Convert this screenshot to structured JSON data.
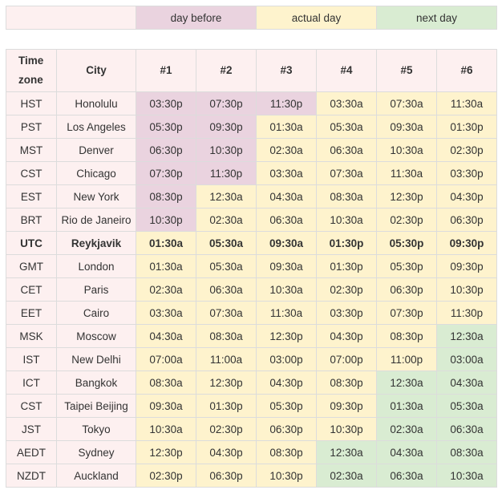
{
  "legend": {
    "day_before": "day before",
    "actual_day": "actual day",
    "next_day": "next day"
  },
  "colors": {
    "day_before": "#ead3df",
    "actual_day": "#fef3cd",
    "next_day": "#d9ecd2",
    "label_bg": "#fdf0f0"
  },
  "headers": [
    "Time zone",
    "City",
    "#1",
    "#2",
    "#3",
    "#4",
    "#5",
    "#6"
  ],
  "rows": [
    {
      "tz": "HST",
      "city": "Honolulu",
      "times": [
        "03:30p",
        "07:30p",
        "11:30p",
        "03:30a",
        "07:30a",
        "11:30a"
      ],
      "days": [
        "before",
        "before",
        "before",
        "actual",
        "actual",
        "actual"
      ]
    },
    {
      "tz": "PST",
      "city": "Los Angeles",
      "times": [
        "05:30p",
        "09:30p",
        "01:30a",
        "05:30a",
        "09:30a",
        "01:30p"
      ],
      "days": [
        "before",
        "before",
        "actual",
        "actual",
        "actual",
        "actual"
      ]
    },
    {
      "tz": "MST",
      "city": "Denver",
      "times": [
        "06:30p",
        "10:30p",
        "02:30a",
        "06:30a",
        "10:30a",
        "02:30p"
      ],
      "days": [
        "before",
        "before",
        "actual",
        "actual",
        "actual",
        "actual"
      ]
    },
    {
      "tz": "CST",
      "city": "Chicago",
      "times": [
        "07:30p",
        "11:30p",
        "03:30a",
        "07:30a",
        "11:30a",
        "03:30p"
      ],
      "days": [
        "before",
        "before",
        "actual",
        "actual",
        "actual",
        "actual"
      ]
    },
    {
      "tz": "EST",
      "city": "New York",
      "times": [
        "08:30p",
        "12:30a",
        "04:30a",
        "08:30a",
        "12:30p",
        "04:30p"
      ],
      "days": [
        "before",
        "actual",
        "actual",
        "actual",
        "actual",
        "actual"
      ]
    },
    {
      "tz": "BRT",
      "city": "Rio de Janeiro",
      "times": [
        "10:30p",
        "02:30a",
        "06:30a",
        "10:30a",
        "02:30p",
        "06:30p"
      ],
      "days": [
        "before",
        "actual",
        "actual",
        "actual",
        "actual",
        "actual"
      ]
    },
    {
      "tz": "UTC",
      "city": "Reykjavik",
      "times": [
        "01:30a",
        "05:30a",
        "09:30a",
        "01:30p",
        "05:30p",
        "09:30p"
      ],
      "days": [
        "actual",
        "actual",
        "actual",
        "actual",
        "actual",
        "actual"
      ],
      "bold": true
    },
    {
      "tz": "GMT",
      "city": "London",
      "times": [
        "01:30a",
        "05:30a",
        "09:30a",
        "01:30p",
        "05:30p",
        "09:30p"
      ],
      "days": [
        "actual",
        "actual",
        "actual",
        "actual",
        "actual",
        "actual"
      ]
    },
    {
      "tz": "CET",
      "city": "Paris",
      "times": [
        "02:30a",
        "06:30a",
        "10:30a",
        "02:30p",
        "06:30p",
        "10:30p"
      ],
      "days": [
        "actual",
        "actual",
        "actual",
        "actual",
        "actual",
        "actual"
      ]
    },
    {
      "tz": "EET",
      "city": "Cairo",
      "times": [
        "03:30a",
        "07:30a",
        "11:30a",
        "03:30p",
        "07:30p",
        "11:30p"
      ],
      "days": [
        "actual",
        "actual",
        "actual",
        "actual",
        "actual",
        "actual"
      ]
    },
    {
      "tz": "MSK",
      "city": "Moscow",
      "times": [
        "04:30a",
        "08:30a",
        "12:30p",
        "04:30p",
        "08:30p",
        "12:30a"
      ],
      "days": [
        "actual",
        "actual",
        "actual",
        "actual",
        "actual",
        "next"
      ]
    },
    {
      "tz": "IST",
      "city": "New Delhi",
      "times": [
        "07:00a",
        "11:00a",
        "03:00p",
        "07:00p",
        "11:00p",
        "03:00a"
      ],
      "days": [
        "actual",
        "actual",
        "actual",
        "actual",
        "actual",
        "next"
      ]
    },
    {
      "tz": "ICT",
      "city": "Bangkok",
      "times": [
        "08:30a",
        "12:30p",
        "04:30p",
        "08:30p",
        "12:30a",
        "04:30a"
      ],
      "days": [
        "actual",
        "actual",
        "actual",
        "actual",
        "next",
        "next"
      ]
    },
    {
      "tz": "CST",
      "city": "Taipei Beijing",
      "times": [
        "09:30a",
        "01:30p",
        "05:30p",
        "09:30p",
        "01:30a",
        "05:30a"
      ],
      "days": [
        "actual",
        "actual",
        "actual",
        "actual",
        "next",
        "next"
      ]
    },
    {
      "tz": "JST",
      "city": "Tokyo",
      "times": [
        "10:30a",
        "02:30p",
        "06:30p",
        "10:30p",
        "02:30a",
        "06:30a"
      ],
      "days": [
        "actual",
        "actual",
        "actual",
        "actual",
        "next",
        "next"
      ]
    },
    {
      "tz": "AEDT",
      "city": "Sydney",
      "times": [
        "12:30p",
        "04:30p",
        "08:30p",
        "12:30a",
        "04:30a",
        "08:30a"
      ],
      "days": [
        "actual",
        "actual",
        "actual",
        "next",
        "next",
        "next"
      ]
    },
    {
      "tz": "NZDT",
      "city": "Auckland",
      "times": [
        "02:30p",
        "06:30p",
        "10:30p",
        "02:30a",
        "06:30a",
        "10:30a"
      ],
      "days": [
        "actual",
        "actual",
        "actual",
        "next",
        "next",
        "next"
      ]
    }
  ]
}
